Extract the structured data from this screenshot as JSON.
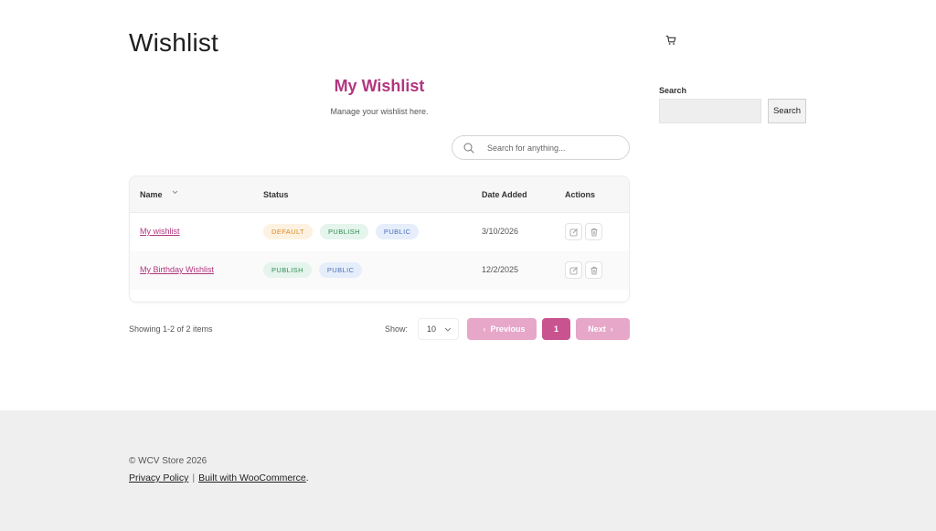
{
  "site": {
    "title": "Wishlist"
  },
  "wishlist": {
    "heading": "My Wishlist",
    "subheading": "Manage your wishlist here.",
    "search_placeholder": "Search for anything..."
  },
  "table": {
    "columns": [
      "Name",
      "Status",
      "Date Added",
      "Actions"
    ],
    "rows": [
      {
        "name": "My wishlist",
        "badges": [
          "DEFAULT",
          "PUBLISH",
          "PUBLIC"
        ],
        "date": "3/10/2026"
      },
      {
        "name": "My Birthday Wishlist",
        "badges": [
          "PUBLISH",
          "PUBLIC"
        ],
        "date": "12/2/2025"
      }
    ]
  },
  "pagination": {
    "showing": "Showing 1-2 of 2 items",
    "show_label": "Show:",
    "per_page": "10",
    "prev": "Previous",
    "current": "1",
    "next": "Next"
  },
  "sidebar": {
    "search_label": "Search",
    "search_value": "",
    "search_button": "Search"
  },
  "footer": {
    "copyright": "© WCV Store 2026",
    "privacy": "Privacy Policy",
    "separator": "|",
    "built": "Built with WooCommerce",
    "period": "."
  },
  "icons": [
    "cart-icon",
    "search-icon",
    "sort-chevron-icon",
    "edit-icon",
    "trash-icon",
    "chevron-down-icon",
    "chevron-left-icon",
    "chevron-right-icon"
  ],
  "colors": {
    "accent": "#b2367e",
    "page_btn": "#e6a7c9",
    "page_current": "#c8538f",
    "default_badge": "#d98b23",
    "publish_badge": "#2f8f57",
    "public_badge": "#4b6fb6"
  }
}
